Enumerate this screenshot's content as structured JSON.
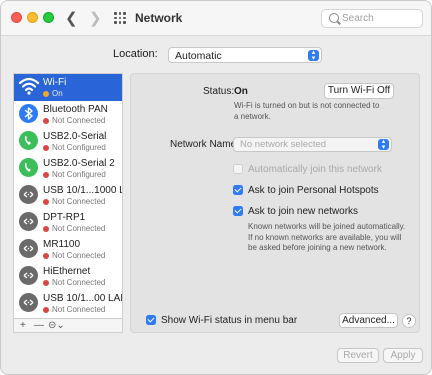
{
  "window": {
    "title": "Network",
    "search_placeholder": "Search"
  },
  "location": {
    "label": "Location:",
    "value": "Automatic"
  },
  "services": [
    {
      "name": "Wi-Fi",
      "status": "On",
      "status_color": "#f5a623",
      "icon": "wifi-icon",
      "selected": true
    },
    {
      "name": "Bluetooth PAN",
      "status": "Not Connected",
      "status_color": "#e0443e",
      "icon": "bluetooth-icon"
    },
    {
      "name": "USB2.0-Serial",
      "status": "Not Configured",
      "status_color": "#e0443e",
      "icon": "phone-icon"
    },
    {
      "name": "USB2.0-Serial 2",
      "status": "Not Configured",
      "status_color": "#e0443e",
      "icon": "phone-icon"
    },
    {
      "name": "USB 10/1...1000 LAN",
      "status": "Not Connected",
      "status_color": "#e0443e",
      "icon": "ethernet-icon"
    },
    {
      "name": "DPT-RP1",
      "status": "Not Connected",
      "status_color": "#e0443e",
      "icon": "ethernet-icon"
    },
    {
      "name": "MR1100",
      "status": "Not Connected",
      "status_color": "#e0443e",
      "icon": "ethernet-icon"
    },
    {
      "name": "HiEthernet",
      "status": "Not Connected",
      "status_color": "#e0443e",
      "icon": "ethernet-icon"
    },
    {
      "name": "USB 10/1...00 LAN 2",
      "status": "Not Connected",
      "status_color": "#e0443e",
      "icon": "ethernet-icon"
    }
  ],
  "sidebar_controls": {
    "add": "+",
    "remove": "—",
    "action": "⊝⌄"
  },
  "detail": {
    "status_label": "Status:",
    "status_value": "On",
    "turn_off_button": "Turn Wi-Fi Off",
    "status_desc": "Wi-Fi is turned on but is not connected to a network.",
    "network_name_label": "Network Name:",
    "network_name_placeholder": "No network selected",
    "auto_join": {
      "label": "Automatically join this network",
      "checked": false,
      "disabled": true
    },
    "personal_hotspots": {
      "label": "Ask to join Personal Hotspots",
      "checked": true
    },
    "new_networks": {
      "label": "Ask to join new networks",
      "checked": true
    },
    "new_networks_desc": "Known networks will be joined automatically. If no known networks are available, you will be asked before joining a new network.",
    "show_status": {
      "label": "Show Wi-Fi status in menu bar",
      "checked": true
    },
    "advanced_button": "Advanced...",
    "help": "?"
  },
  "footer": {
    "revert": "Revert",
    "apply": "Apply"
  },
  "colors": {
    "accent": "#2f7bf6",
    "selection": "#2965d6"
  }
}
